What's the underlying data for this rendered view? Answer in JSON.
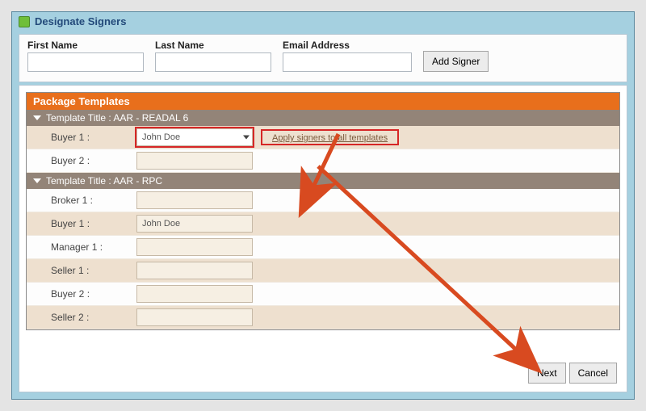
{
  "window": {
    "title": "Designate Signers"
  },
  "form": {
    "firstName": {
      "label": "First Name",
      "value": ""
    },
    "lastName": {
      "label": "Last Name",
      "value": ""
    },
    "email": {
      "label": "Email Address",
      "value": ""
    },
    "addSigner": "Add Signer"
  },
  "package": {
    "title": "Package Templates",
    "templates": [
      {
        "title": "Template Title : AAR - READAL 6",
        "roles": [
          {
            "label": "Buyer 1 :",
            "value": "John Doe",
            "isSelect": true,
            "applyLink": "Apply signers to all templates",
            "highlight": true,
            "alt": true
          },
          {
            "label": "Buyer 2 :",
            "value": ""
          }
        ]
      },
      {
        "title": "Template Title : AAR - RPC",
        "roles": [
          {
            "label": "Broker 1 :",
            "value": ""
          },
          {
            "label": "Buyer 1 :",
            "value": "John Doe",
            "alt": true
          },
          {
            "label": "Manager 1 :",
            "value": ""
          },
          {
            "label": "Seller 1 :",
            "value": "",
            "alt": true
          },
          {
            "label": "Buyer 2 :",
            "value": ""
          },
          {
            "label": "Seller 2 :",
            "value": "",
            "alt": true
          }
        ]
      }
    ]
  },
  "footer": {
    "next": "Next",
    "cancel": "Cancel"
  },
  "colors": {
    "accent": "#e86f1c",
    "header": "#938478",
    "highlight": "#d62626",
    "panel": "#a5d0e0"
  }
}
